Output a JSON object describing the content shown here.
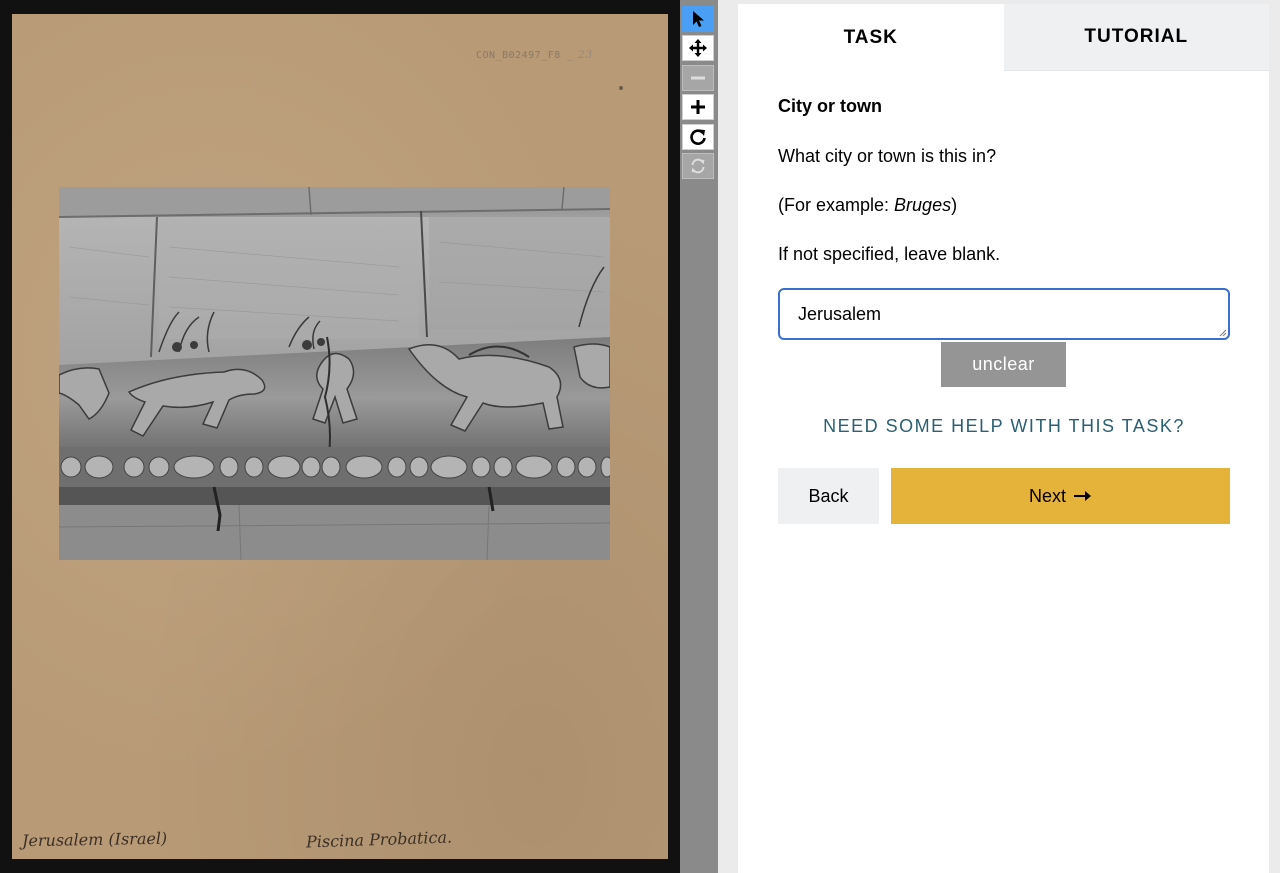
{
  "viewer": {
    "reference_code": "CON_B02497_F8",
    "page_number": "23",
    "annotation_location": "Jerusalem (Israel)",
    "annotation_site": "Piscina Probatica."
  },
  "toolbar": {
    "tools": [
      {
        "name": "select",
        "icon": "pointer-arrow-icon",
        "state": "active"
      },
      {
        "name": "move",
        "icon": "move-arrows-icon",
        "state": "enabled"
      },
      {
        "name": "zoom-out",
        "icon": "minus-icon",
        "state": "disabled"
      },
      {
        "name": "zoom-in",
        "icon": "plus-icon",
        "state": "enabled"
      },
      {
        "name": "rotate",
        "icon": "rotate-icon",
        "state": "enabled"
      },
      {
        "name": "reset",
        "icon": "refresh-icon",
        "state": "disabled"
      }
    ]
  },
  "tabs": {
    "task": "TASK",
    "tutorial": "TUTORIAL",
    "active": "task"
  },
  "task": {
    "title": "City or town",
    "question": "What city or town is this in?",
    "example_prefix": "(For example: ",
    "example_value": "Bruges",
    "example_suffix": ")",
    "instruction": "If not specified, leave blank.",
    "answer_value": "Jerusalem",
    "unclear_label": "unclear",
    "help_label": "NEED SOME HELP WITH THIS TASK?",
    "back_label": "Back",
    "next_label": "Next",
    "next_icon": "arrow-right-icon"
  },
  "colors": {
    "accent": "#e6b33a",
    "focus": "#3b6fcf",
    "help": "#2b5f73",
    "active_tool": "#4a9ff5"
  }
}
